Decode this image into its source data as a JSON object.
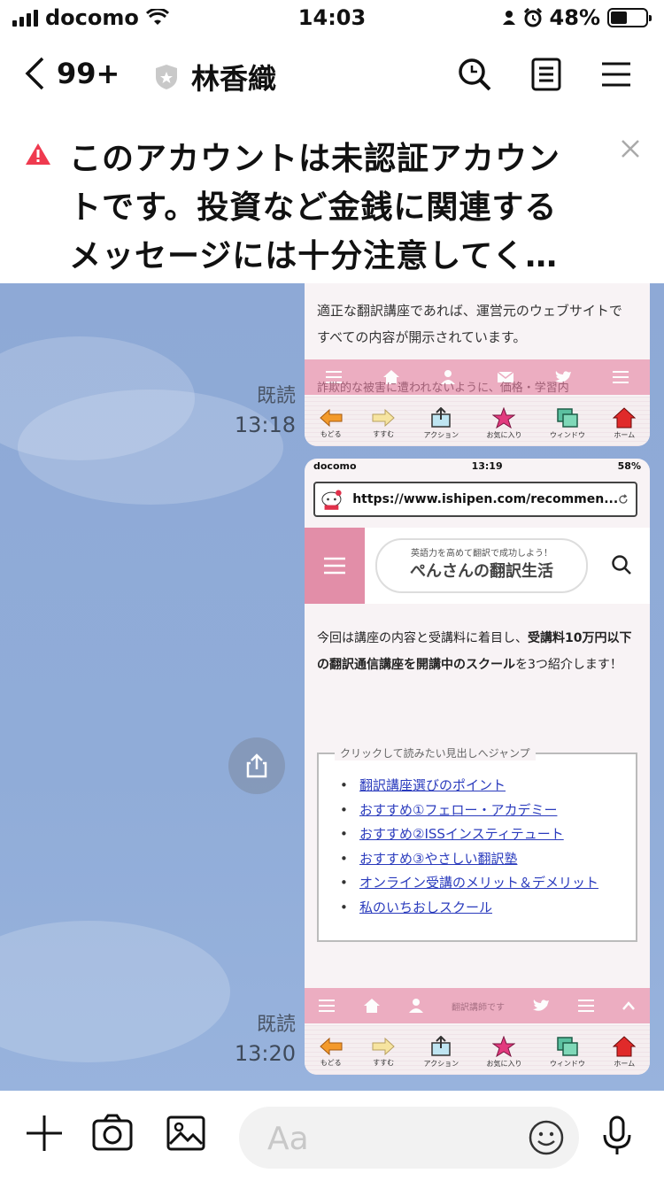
{
  "status_bar": {
    "carrier": "docomo",
    "time": "14:03",
    "battery": "48%",
    "battery_level": 0.48
  },
  "header": {
    "back_count": "99+",
    "room_name": "林香織",
    "icons": [
      "search-icon",
      "notes-icon",
      "menu-icon"
    ]
  },
  "warning": {
    "text": "このアカウントは未認証アカウントです。投資など金銭に関連するメッセージには十分注意してく…"
  },
  "messages": [
    {
      "read_label": "既読",
      "time": "13:18",
      "image": {
        "article_line1": "適正な翻訳講座であれば、運営元のウェブサイトで",
        "article_line2": "すべての内容が開示されています。",
        "article_line3": "詐欺的な被害に遭われないように、価格・学習内",
        "toolbar": [
          "もどる",
          "すすむ",
          "アクション",
          "お気に入り",
          "ウィンドウ",
          "ホーム"
        ]
      }
    },
    {
      "read_label": "既読",
      "time": "13:20",
      "image": {
        "phone_carrier": "docomo",
        "phone_time": "13:19",
        "phone_battery": "58%",
        "url": "https://www.ishipen.com/recommen...",
        "site_subtitle": "英語力を高めて翻訳で成功しよう！",
        "site_title": "ぺんさんの翻訳生活",
        "intro_1": "今回は講座の内容と受講料に着目し、",
        "intro_bold": "受講料10万円以下の翻訳通信講座を開講中のスクール",
        "intro_2": "を3つ紹介します！",
        "toc_title": "クリックして読みたい見出しへジャンプ",
        "toc_items": [
          "翻訳講座選びのポイント",
          "おすすめ①フェロー・アカデミー",
          "おすすめ②ISSインスティテュート",
          "おすすめ③やさしい翻訳塾",
          "オンライン受講のメリット＆デメリット",
          "私のいちおしスクール"
        ],
        "footer_text": "翻訳講師です",
        "toolbar": [
          "もどる",
          "すすむ",
          "アクション",
          "お気に入り",
          "ウィンドウ",
          "ホーム"
        ]
      }
    }
  ],
  "input": {
    "placeholder": "Aa"
  }
}
